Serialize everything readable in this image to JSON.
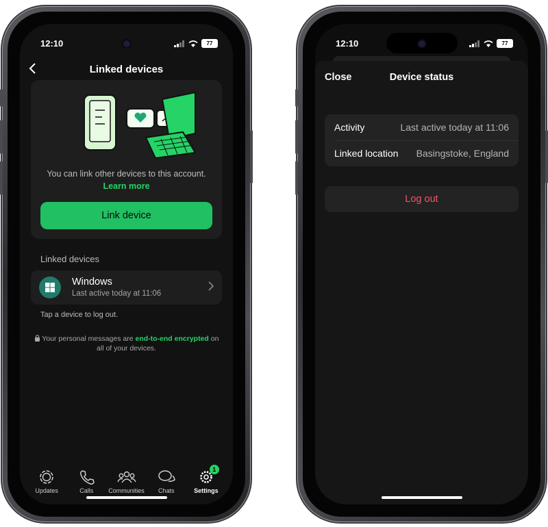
{
  "left": {
    "status": {
      "time": "12:10",
      "battery": "77"
    },
    "header": {
      "back_icon": "chevron-left-icon",
      "title": "Linked devices"
    },
    "card": {
      "description": "You can link other devices to this account.",
      "learn_more": "Learn more",
      "link_button": "Link device"
    },
    "section_title": "Linked devices",
    "device": {
      "name": "Windows",
      "last_active": "Last active today at 11:06",
      "icon": "windows-icon"
    },
    "tap_hint": "Tap a device to log out.",
    "encryption": {
      "prefix": "Your personal messages are ",
      "highlight": "end-to-end encrypted",
      "suffix": " on all of your devices."
    },
    "tabs": [
      {
        "label": "Updates",
        "icon": "updates-icon"
      },
      {
        "label": "Calls",
        "icon": "phone-icon"
      },
      {
        "label": "Communities",
        "icon": "communities-icon"
      },
      {
        "label": "Chats",
        "icon": "chats-icon"
      },
      {
        "label": "Settings",
        "icon": "settings-icon",
        "badge": "1",
        "active": true
      }
    ],
    "colors": {
      "accent": "#25d366",
      "button": "#21c063",
      "background": "#121212"
    }
  },
  "right": {
    "status": {
      "time": "12:10",
      "battery": "77"
    },
    "sheet": {
      "close": "Close",
      "title": "Device status"
    },
    "info": [
      {
        "label": "Activity",
        "value": "Last active today at 11:06"
      },
      {
        "label": "Linked location",
        "value": "Basingstoke, England"
      }
    ],
    "logout": "Log out",
    "colors": {
      "logout": "#f0566a"
    }
  }
}
